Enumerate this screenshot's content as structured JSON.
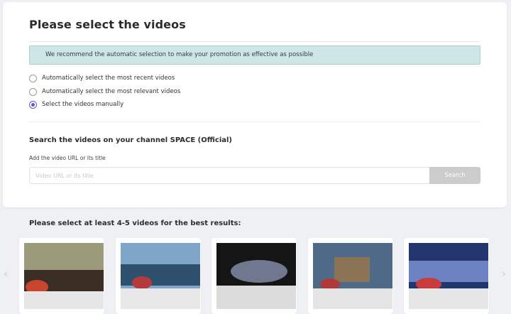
{
  "header": {
    "title": "Please select the videos"
  },
  "alert": {
    "text": "We recommend the automatic selection to make your promotion as effective as possible"
  },
  "options": [
    {
      "label": "Automatically select the most recent videos",
      "checked": false
    },
    {
      "label": "Automatically select the most relevant videos",
      "checked": false
    },
    {
      "label": "Select the videos manually",
      "checked": true
    }
  ],
  "search": {
    "title": "Search the videos on your channel SPACE (Official)",
    "subtitle": "Add the video URL or its title",
    "placeholder": "Video URL or its title",
    "button_label": "Search"
  },
  "videos": {
    "title": "Please select at least 4-5 videos for the best results:",
    "prev_icon": "chevron-left-icon",
    "next_icon": "chevron-right-icon",
    "thumbnails": [
      {
        "icon": "video-thumbnail-1",
        "colors": [
          "#8a8a70",
          "#3a2e24",
          "#c8452f"
        ]
      },
      {
        "icon": "video-thumbnail-2",
        "colors": [
          "#7fa5c9",
          "#2f4f6f",
          "#b53b3b"
        ]
      },
      {
        "icon": "video-thumbnail-3",
        "colors": [
          "#151515",
          "#707890",
          "#dcdcdc"
        ]
      },
      {
        "icon": "video-thumbnail-4",
        "colors": [
          "#4f6a88",
          "#8b7355",
          "#b03a3a"
        ]
      },
      {
        "icon": "video-thumbnail-5",
        "colors": [
          "#23356e",
          "#6d82c2",
          "#c83c3c"
        ]
      }
    ]
  }
}
